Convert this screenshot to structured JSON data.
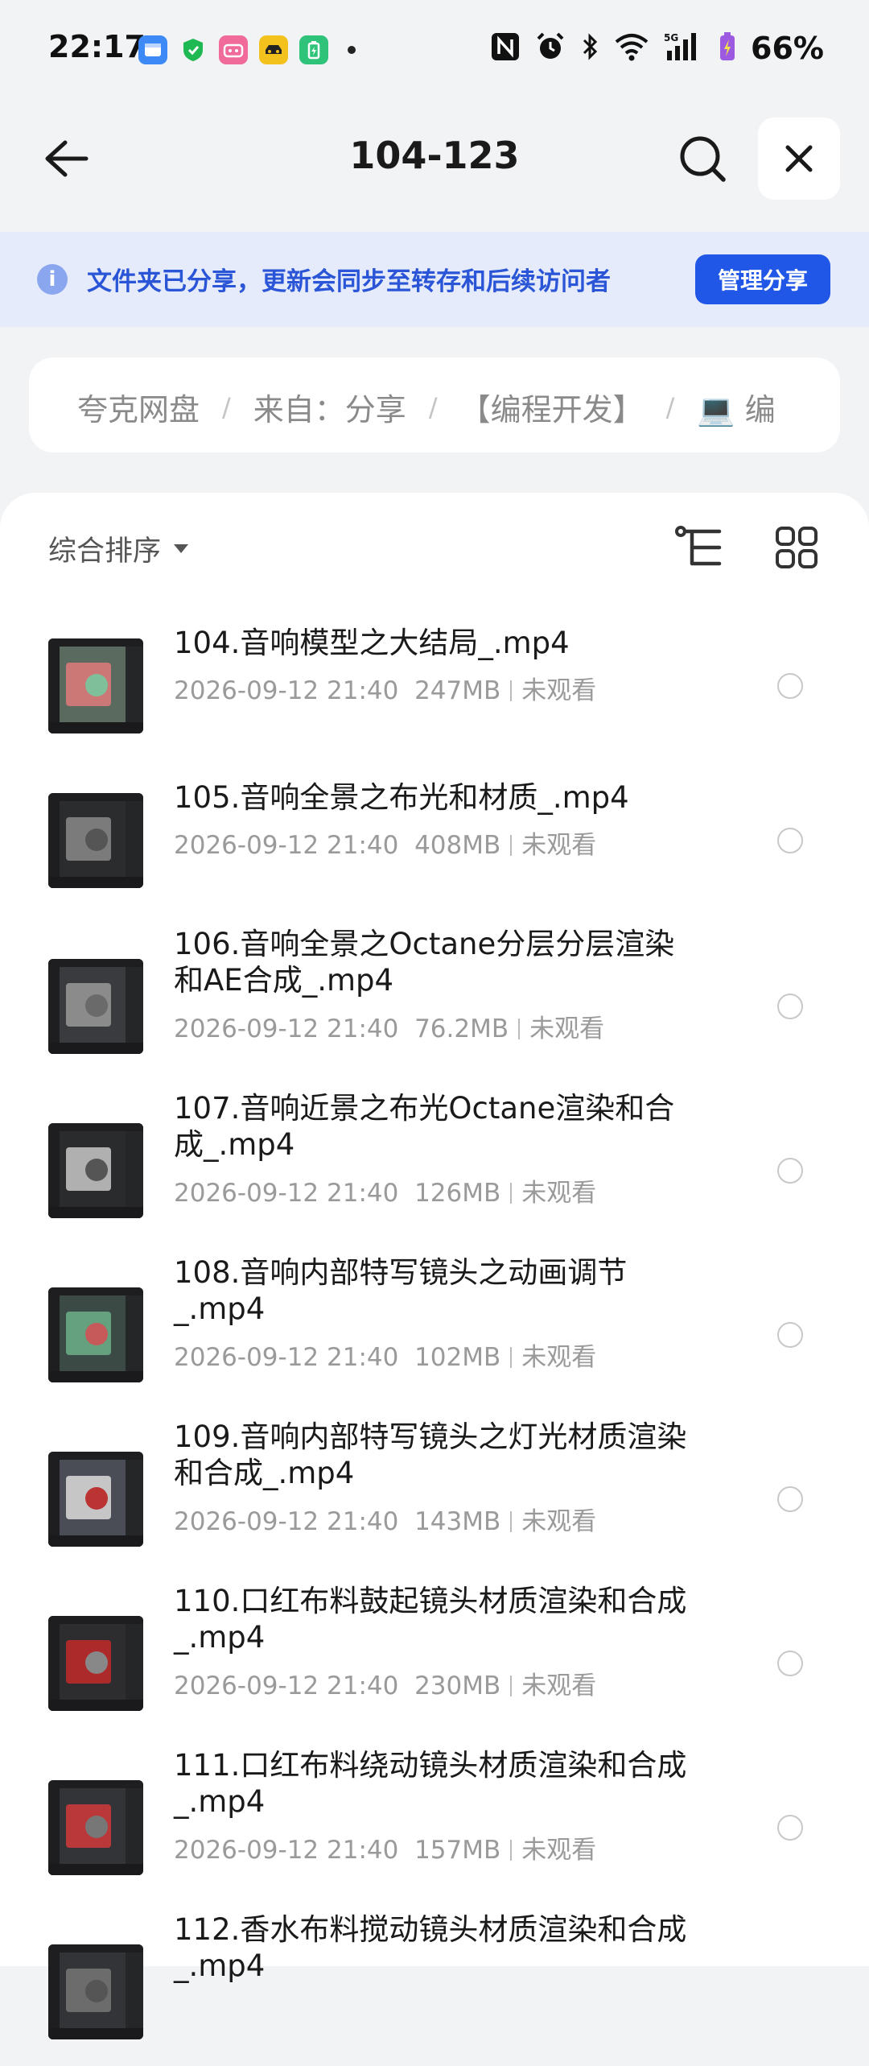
{
  "status_bar": {
    "time": "22:17",
    "battery": "66%"
  },
  "header": {
    "title": "104-123"
  },
  "banner": {
    "text": "文件夹已分享，更新会同步至转存和后续访问者",
    "button": "管理分享"
  },
  "breadcrumb": [
    "夸克网盘",
    "来自：分享",
    "【编程开发】",
    "💻 编"
  ],
  "toolbar": {
    "sort_label": "综合排序"
  },
  "files": [
    {
      "name": "104.音响模型之大结局_.mp4",
      "date": "2026-09-12 21:40",
      "size": "247MB",
      "status": "未观看"
    },
    {
      "name": "105.音响全景之布光和材质_.mp4",
      "date": "2026-09-12 21:40",
      "size": "408MB",
      "status": "未观看"
    },
    {
      "name": "106.音响全景之Octane分层分层渲染和AE合成_.mp4",
      "date": "2026-09-12 21:40",
      "size": "76.2MB",
      "status": "未观看"
    },
    {
      "name": "107.音响近景之布光Octane渲染和合成_.mp4",
      "date": "2026-09-12 21:40",
      "size": "126MB",
      "status": "未观看"
    },
    {
      "name": "108.音响内部特写镜头之动画调节_.mp4",
      "date": "2026-09-12 21:40",
      "size": "102MB",
      "status": "未观看"
    },
    {
      "name": "109.音响内部特写镜头之灯光材质渲染和合成_.mp4",
      "date": "2026-09-12 21:40",
      "size": "143MB",
      "status": "未观看"
    },
    {
      "name": "110.口红布料鼓起镜头材质渲染和合成_.mp4",
      "date": "2026-09-12 21:40",
      "size": "230MB",
      "status": "未观看"
    },
    {
      "name": "111.口红布料绕动镜头材质渲染和合成_.mp4",
      "date": "2026-09-12 21:40",
      "size": "157MB",
      "status": "未观看"
    },
    {
      "name": "112.香水布料搅动镜头材质渲染和合成_.mp4",
      "date": "",
      "size": "",
      "status": ""
    }
  ],
  "colors": {
    "accent": "#2157e6",
    "banner_bg": "#e5ebfb",
    "banner_text": "#2a55d6"
  }
}
